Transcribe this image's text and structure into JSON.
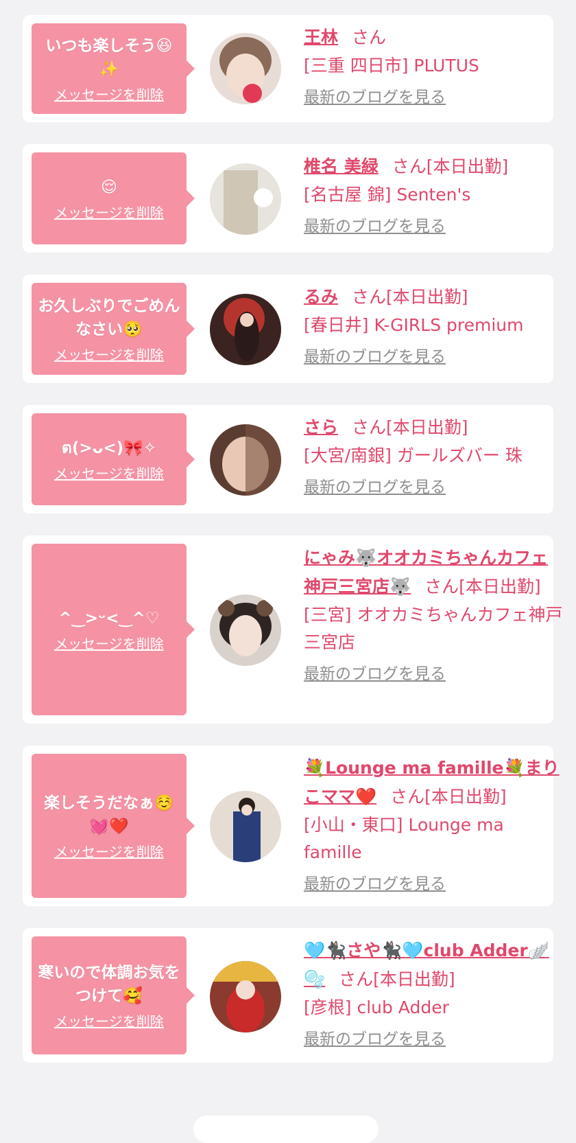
{
  "delete_label": "メッセージを削除",
  "blog_label": "最新のブログを見る",
  "san_label": "さん",
  "colors": {
    "background": "#f2f2f4",
    "bubble": "#f592a4",
    "name": "#e0486b",
    "link_gray": "#8f8f8f"
  },
  "entries": [
    {
      "message": "いつも楽しそう😆✨",
      "name": "王林",
      "status": "",
      "shop": "[三重 四日市] PLUTUS"
    },
    {
      "message": "😌",
      "name": "椎名 美緑",
      "status": "[本日出勤]",
      "shop": "[名古屋 錦] Senten's"
    },
    {
      "message": "お久しぶりでごめんなさい🥺",
      "name": "るみ",
      "status": "[本日出勤]",
      "shop": "[春日井] K-GIRLS premium"
    },
    {
      "message": "ต(>ᴗ<)🎀✧",
      "name": "さら",
      "status": "[本日出勤]",
      "shop": "[大宮/南銀] ガールズバー 珠"
    },
    {
      "message": "^‿>ᵕ<‿^♡",
      "name": "にゃみ🐺オオカミちゃんカフェ神戸三宮店🐺",
      "status": "[本日出勤]",
      "shop": "[三宮] オオカミちゃんカフェ神戸三宮店"
    },
    {
      "message": "楽しそうだなぁ☺️💓❤️",
      "name": "💐Lounge ma famille💐まりこママ❤️",
      "status": "[本日出勤]",
      "shop": "[小山・東口] Lounge ma famille"
    },
    {
      "message": "寒いので体調お気をつけて🥰",
      "name": "🩵🐈‍⬛さや🐈‍⬛🩵club Adder🪽🫧",
      "status": "[本日出勤]",
      "shop": "[彦根] club Adder"
    }
  ]
}
